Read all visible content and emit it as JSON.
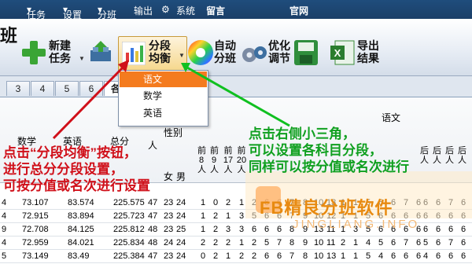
{
  "menu": {
    "task": "任务",
    "settings": "设置",
    "classes": "分班",
    "output": "输出",
    "system": "系统",
    "message": "留言",
    "website": "官网"
  },
  "app_brand_char": "班",
  "toolbar": {
    "new_task": [
      "新建",
      "任务"
    ],
    "segment_balance": [
      "分段",
      "均衡"
    ],
    "auto_class": [
      "自动",
      "分班"
    ],
    "optimize": [
      "优化",
      "调节"
    ],
    "export": [
      "导出",
      "结果"
    ]
  },
  "tabs": [
    "3",
    "4",
    "5",
    "6",
    "各"
  ],
  "dropdown": {
    "options": [
      "语文",
      "数学",
      "英语"
    ],
    "selected": "语文"
  },
  "grid": {
    "header_chinese_top": "语文",
    "gender_header": "性别",
    "col_labels": [
      "数学",
      "英语",
      "总分"
    ],
    "ren": "人",
    "female": "女",
    "male": "男",
    "vertical_cols": [
      [
        "前",
        "8",
        "人"
      ],
      [
        "前",
        "9",
        "人"
      ],
      [
        "前",
        "17",
        "人"
      ],
      [
        "前",
        "20",
        "人"
      ],
      [
        "后",
        "人"
      ],
      [
        "后",
        "人"
      ],
      [
        "后",
        "人"
      ],
      [
        "后",
        "人"
      ]
    ],
    "rows": [
      {
        "id": "4",
        "math": "73.107",
        "eng": "83.574",
        "total": "225.575",
        "a": "47",
        "b": "23",
        "c": "24",
        "v": [
          "1",
          "0",
          "2",
          "1",
          "2",
          "6",
          "6",
          "7",
          "8",
          "10",
          "13",
          "1",
          "1",
          "5",
          "6",
          "6",
          "7",
          "6"
        ]
      },
      {
        "id": "4",
        "math": "72.915",
        "eng": "83.894",
        "total": "225.723",
        "a": "47",
        "b": "23",
        "c": "24",
        "v": [
          "1",
          "2",
          "1",
          "3",
          "5",
          "6",
          "6",
          "7",
          "9",
          "10",
          "12",
          "1",
          "1",
          "5",
          "6",
          "6",
          "6",
          "6"
        ]
      },
      {
        "id": "9",
        "math": "72.708",
        "eng": "84.125",
        "total": "225.812",
        "a": "48",
        "b": "23",
        "c": "25",
        "v": [
          "1",
          "2",
          "3",
          "3",
          "6",
          "6",
          "6",
          "8",
          "9",
          "13",
          "11",
          "1",
          "3",
          "5",
          "6",
          "6",
          "6",
          "6"
        ]
      },
      {
        "id": "4",
        "math": "72.959",
        "eng": "84.021",
        "total": "225.834",
        "a": "48",
        "b": "24",
        "c": "24",
        "v": [
          "2",
          "2",
          "2",
          "1",
          "2",
          "5",
          "7",
          "8",
          "9",
          "10",
          "11",
          "2",
          "1",
          "4",
          "5",
          "6",
          "7",
          "6"
        ]
      },
      {
        "id": "5",
        "math": "73.149",
        "eng": "83.49",
        "total": "225.384",
        "a": "47",
        "b": "23",
        "c": "24",
        "v": [
          "0",
          "2",
          "1",
          "2",
          "2",
          "6",
          "6",
          "7",
          "8",
          "10",
          "13",
          "1",
          "1",
          "5",
          "4",
          "6",
          "6",
          "6"
        ]
      }
    ]
  },
  "notes": {
    "red": [
      "点击“分段均衡”按钮，",
      "进行总分分段设置，",
      "可按分值或名次进行设置"
    ],
    "green": [
      "点击右侧小三角，",
      "可以设置各科目分段，",
      "同样可以按分值或名次进行"
    ]
  },
  "watermark": {
    "title": "FB精良分班软件",
    "url": "JINGLIANG.INFO"
  },
  "colors": {
    "menubar": "#1f4d7c",
    "highlight": "#f47b1e",
    "red_note": "#d0101a",
    "green_note": "#10a020"
  }
}
